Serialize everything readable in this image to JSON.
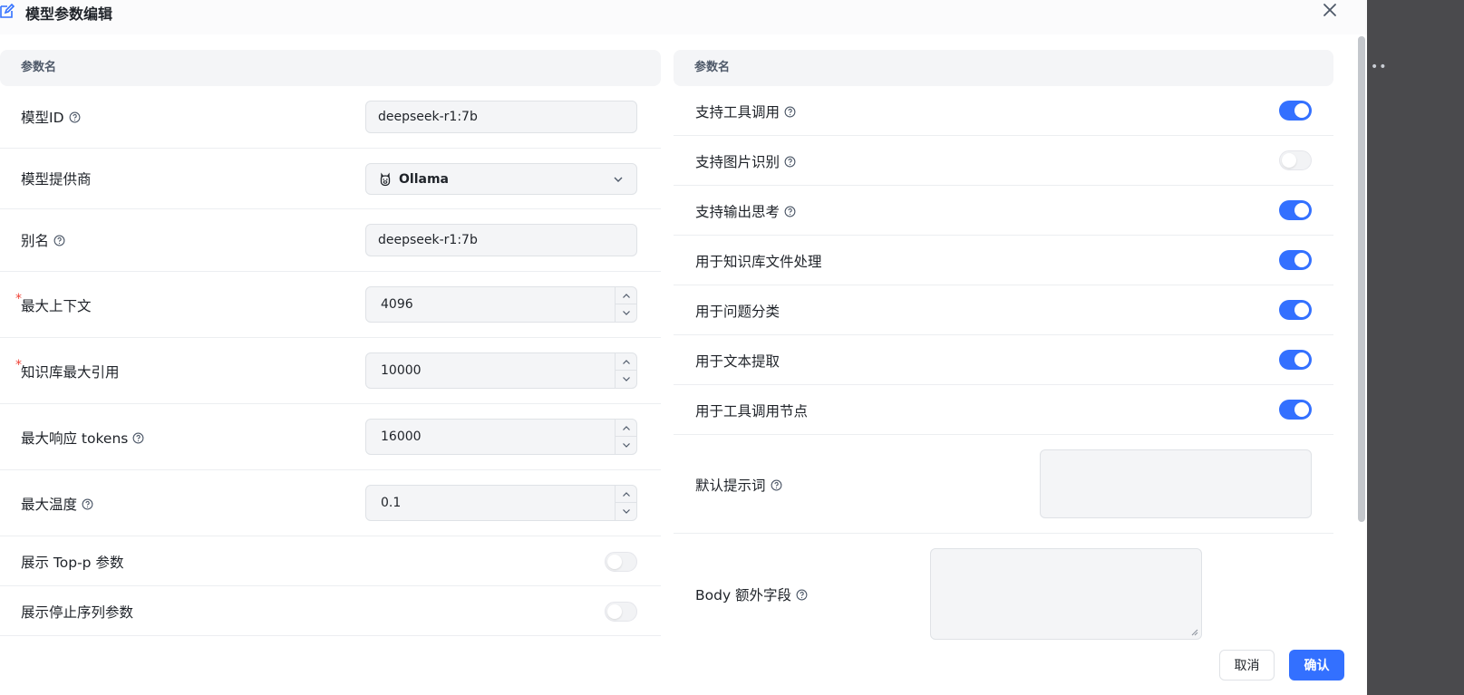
{
  "dialog": {
    "title": "模型参数编辑",
    "left_header": "参数名",
    "right_header": "参数名"
  },
  "left_fields": {
    "model_id": {
      "label": "模型ID",
      "value": "deepseek-r1:7b"
    },
    "provider": {
      "label": "模型提供商",
      "value": "Ollama"
    },
    "alias": {
      "label": "别名",
      "value": "deepseek-r1:7b"
    },
    "max_context": {
      "label": "最大上下文",
      "value": "4096",
      "required": true
    },
    "kb_max_ref": {
      "label": "知识库最大引用",
      "value": "10000",
      "required": true
    },
    "max_tokens": {
      "label": "最大响应 tokens",
      "value": "16000"
    },
    "max_temperature": {
      "label": "最大温度",
      "value": "0.1"
    },
    "show_top_p": {
      "label": "展示 Top-p 参数",
      "enabled": false
    },
    "show_stop_seq": {
      "label": "展示停止序列参数",
      "enabled": false
    }
  },
  "right_fields": {
    "tool_call": {
      "label": "支持工具调用",
      "enabled": true
    },
    "image_recog": {
      "label": "支持图片识别",
      "enabled": false
    },
    "output_thinking": {
      "label": "支持输出思考",
      "enabled": true
    },
    "kb_file_process": {
      "label": "用于知识库文件处理",
      "enabled": true
    },
    "question_classify": {
      "label": "用于问题分类",
      "enabled": true
    },
    "text_extract": {
      "label": "用于文本提取",
      "enabled": true
    },
    "tool_call_node": {
      "label": "用于工具调用节点",
      "enabled": true
    },
    "default_prompt": {
      "label": "默认提示词",
      "value": ""
    },
    "body_extra": {
      "label": "Body 额外字段",
      "value": ""
    }
  },
  "buttons": {
    "cancel": "取消",
    "confirm": "确认"
  },
  "colors": {
    "accent": "#3370ff",
    "input_bg": "#f4f5f7",
    "required": "#f04438",
    "backdrop": "#4a4a4d"
  },
  "icons": {
    "title": "edit-icon",
    "close": "close-icon",
    "help": "question-circle-icon",
    "provider": "ollama-llama-icon",
    "select_arrow": "chevron-down-icon",
    "step_up": "chevron-up-icon",
    "step_down": "chevron-down-icon"
  }
}
